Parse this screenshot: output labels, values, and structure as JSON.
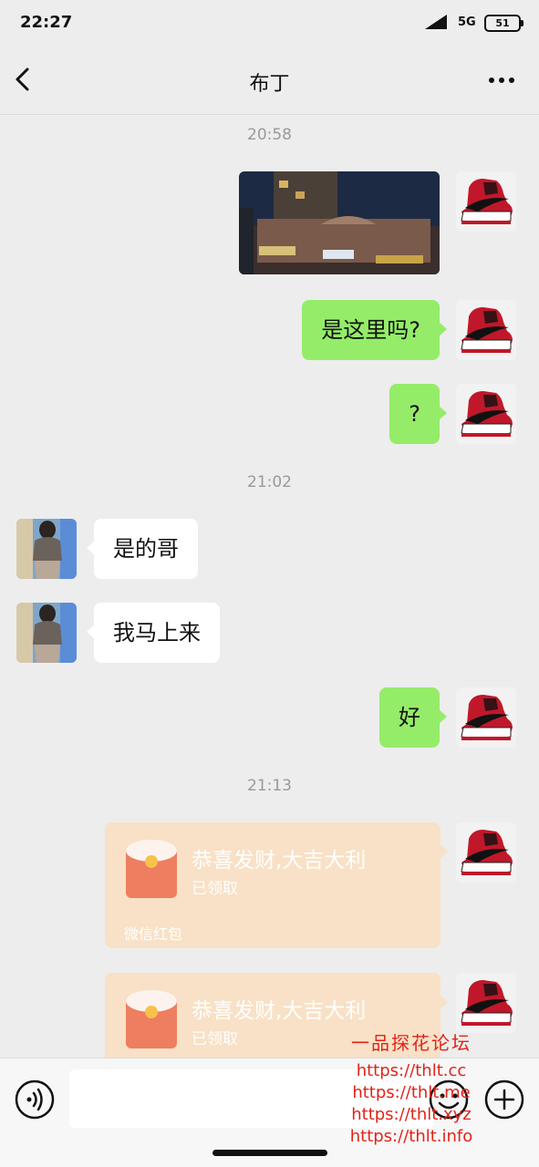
{
  "status_bar": {
    "time": "22:27",
    "network": "5G",
    "battery": "51"
  },
  "nav": {
    "title": "布丁",
    "back_icon": "chevron-left-icon",
    "more_icon": "more-dots-icon"
  },
  "timestamps": [
    "20:58",
    "21:02",
    "21:13"
  ],
  "messages": [
    {
      "sender": "me",
      "type": "image"
    },
    {
      "sender": "me",
      "type": "text",
      "text": "是这里吗?"
    },
    {
      "sender": "me",
      "type": "text",
      "text": "?"
    },
    {
      "sender": "other",
      "type": "text",
      "text": "是的哥"
    },
    {
      "sender": "other",
      "type": "text",
      "text": "我马上来"
    },
    {
      "sender": "me",
      "type": "text",
      "text": "好"
    },
    {
      "sender": "me",
      "type": "red_packet",
      "title": "恭喜发财,大吉大利",
      "status": "已领取",
      "footer": "微信红包"
    },
    {
      "sender": "me",
      "type": "red_packet",
      "title": "恭喜发财,大吉大利",
      "status": "已领取"
    }
  ],
  "input_bar": {
    "placeholder": "",
    "voice_icon": "voice-icon",
    "emoji_icon": "emoji-icon",
    "plus_icon": "plus-icon"
  },
  "watermark": {
    "title": "一品探花论坛",
    "lines": [
      "https://thlt.cc",
      "https://thlt.me",
      "https://thlt.xyz",
      "https://thlt.info"
    ]
  },
  "colors": {
    "my_bubble": "#95ec69",
    "other_bubble": "#ffffff",
    "background": "#ededed",
    "red_packet": "#f8e1c6",
    "watermark": "#e0241a"
  }
}
